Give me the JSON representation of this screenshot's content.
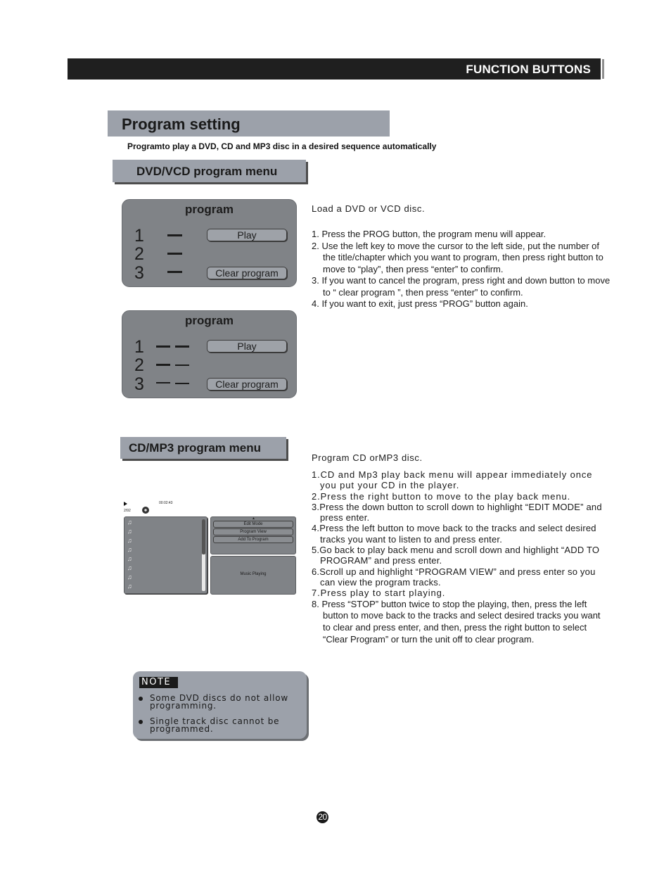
{
  "header": {
    "title": "FUNCTION BUTTONS"
  },
  "section": {
    "title": "Program setting",
    "subtitle": "Programto play  a DVD, CD  and MP3 disc in a desired sequence automatically"
  },
  "dvd_section": {
    "heading": "DVD/VCD program  menu",
    "panels": [
      {
        "title": "program",
        "rows": [
          "1",
          "2",
          "3"
        ],
        "play_label": "Play",
        "clear_label": "Clear  program"
      },
      {
        "title": "program",
        "rows": [
          "1",
          "2",
          "3"
        ],
        "play_label": "Play",
        "clear_label": "Clear  program"
      }
    ],
    "intro": "Load a DVD or VCD  disc.",
    "steps": [
      "1. Press the PROG button, the program menu will appear.",
      "2. Use the left key to move the cursor to the left side, put the number of the title/chapter which you want to program, then press right button to move to “play”, then press “enter” to confirm.",
      "3. If you want to cancel the program, press right and down button to move to “ clear program ”, then press “enter” to confirm.",
      "4. If you want to exit, just press “PROG” button again."
    ]
  },
  "cd_section": {
    "heading": "CD/MP3  program  menu",
    "screen": {
      "time": "00:02:43",
      "track_count": "2/92",
      "menu_items": [
        "Edit Mode",
        "Program View",
        "Add To Program"
      ],
      "status": "Music Playing",
      "track_icon": "music-note-icon",
      "track_rows": 8
    },
    "intro": "Program CD orMP3 disc.",
    "steps": [
      "1.CD  and  Mp3  play  back  menu  will  appear immediately  once  you  put  your  CD  in  the  player.",
      "2.Press  the  right  button  to  move  to  the  play  back  menu.",
      "3.Press  the  down  button  to  scroll down to highlight “EDIT MODE”  and press enter.",
      "4.Press the  left  button to move back to the tracks and select desired tracks you want to listen to and press enter.",
      "5.Go back to play back menu and scroll down and highlight “ADD TO PROGRAM” and press enter.",
      "6.Scroll up and highlight “PROGRAM VIEW” and  press enter  so  you  can  view the program tracks.",
      "7.Press  play  to  start  playing.",
      "8. Press “STOP” button twice to stop the playing, then, press the left button to move back to the tracks and select desired tracks you want to clear and press enter, and then, press the right button to select “Clear Program” or turn the unit off to clear program."
    ]
  },
  "note": {
    "label": "NOTE",
    "items": [
      "Some DVD discs   do not allow programming.",
      "Single track disc   cannot be programmed."
    ]
  },
  "page_number": "20"
}
